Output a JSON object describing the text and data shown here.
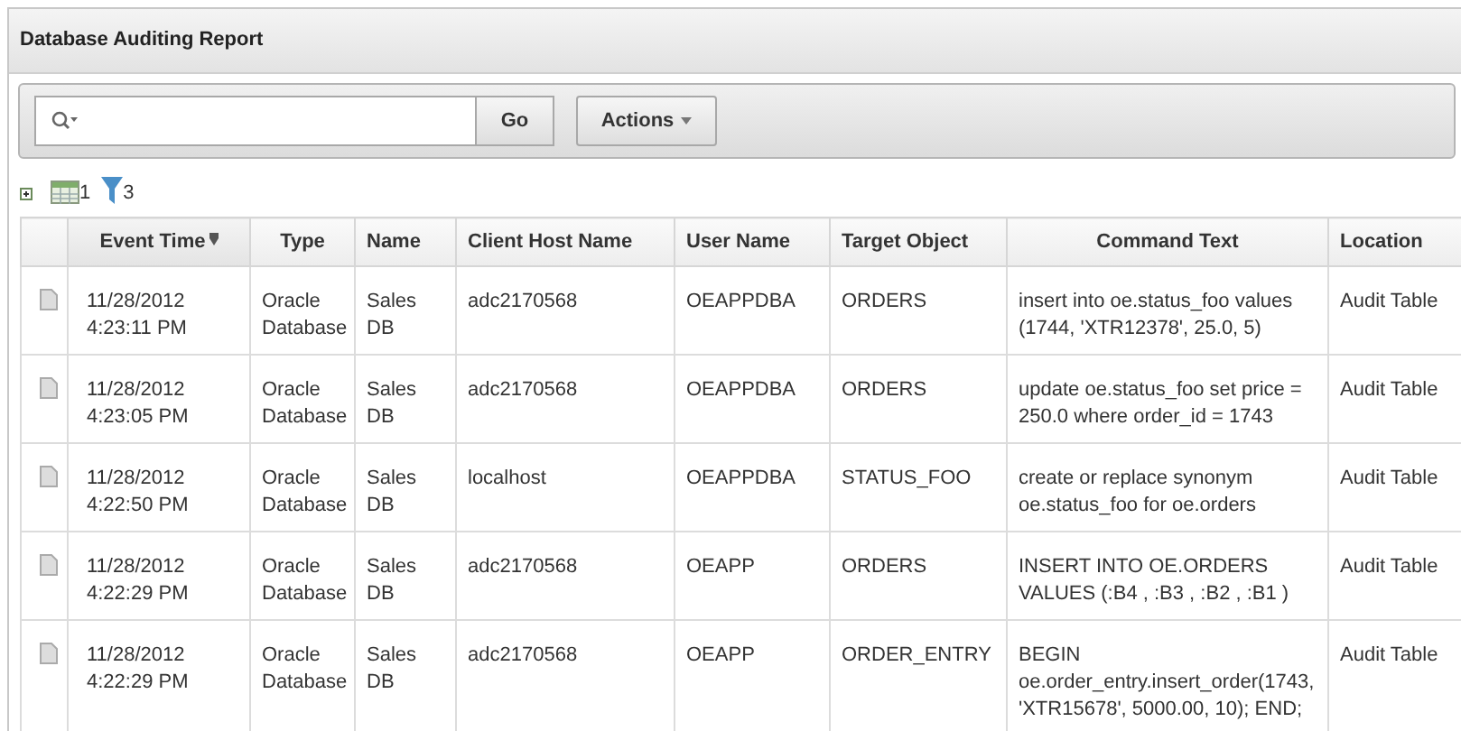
{
  "region": {
    "title": "Database Auditing Report"
  },
  "search": {
    "button": "Go",
    "actions_button": "Actions"
  },
  "report_controls": {
    "view_count": "1",
    "filter_count": "3"
  },
  "table": {
    "columns": [
      {
        "label": "Event Time",
        "sorted": true
      },
      {
        "label": "Type",
        "sorted": false
      },
      {
        "label": "Name",
        "sorted": false
      },
      {
        "label": "Client Host Name",
        "sorted": false
      },
      {
        "label": "User Name",
        "sorted": false
      },
      {
        "label": "Target Object",
        "sorted": false
      },
      {
        "label": "Command Text",
        "sorted": false
      },
      {
        "label": "Location",
        "sorted": false
      }
    ],
    "rows": [
      {
        "cells": [
          "11/28/2012 4:23:11 PM",
          "Oracle Database",
          "Sales DB",
          "adc2170568",
          "OEAPPDBA",
          "ORDERS",
          "insert into oe.status_foo values (1744, 'XTR12378', 25.0, 5)",
          "Audit Table"
        ]
      },
      {
        "cells": [
          "11/28/2012 4:23:05 PM",
          "Oracle Database",
          "Sales DB",
          "adc2170568",
          "OEAPPDBA",
          "ORDERS",
          "update oe.status_foo set price = 250.0 where order_id = 1743",
          "Audit Table"
        ]
      },
      {
        "cells": [
          "11/28/2012 4:22:50 PM",
          "Oracle Database",
          "Sales DB",
          "localhost",
          "OEAPPDBA",
          "STATUS_FOO",
          "create or replace synonym oe.status_foo for oe.orders",
          "Audit Table"
        ]
      },
      {
        "cells": [
          "11/28/2012 4:22:29 PM",
          "Oracle Database",
          "Sales DB",
          "adc2170568",
          "OEAPP",
          "ORDERS",
          "INSERT INTO OE.ORDERS VALUES (:B4 , :B3 , :B2 , :B1 )",
          "Audit Table"
        ]
      },
      {
        "cells": [
          "11/28/2012 4:22:29 PM",
          "Oracle Database",
          "Sales DB",
          "adc2170568",
          "OEAPP",
          "ORDER_ENTRY",
          "BEGIN oe.order_entry.insert_order(1743, 'XTR15678', 5000.00, 10); END;",
          "Audit Table"
        ]
      }
    ]
  }
}
